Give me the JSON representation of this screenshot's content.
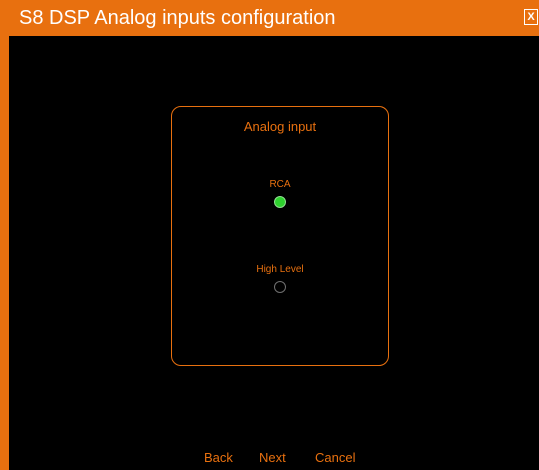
{
  "window": {
    "title": "S8 DSP Analog inputs configuration",
    "close_label": "X"
  },
  "panel": {
    "title": "Analog input",
    "options": [
      {
        "label": "RCA",
        "selected": true
      },
      {
        "label": "High Level",
        "selected": false
      }
    ]
  },
  "navigation": {
    "back_label": "Back",
    "next_label": "Next",
    "cancel_label": "Cancel"
  },
  "colors": {
    "accent": "#e8700f",
    "background": "#000000",
    "selected_radio": "#2ed12e"
  }
}
